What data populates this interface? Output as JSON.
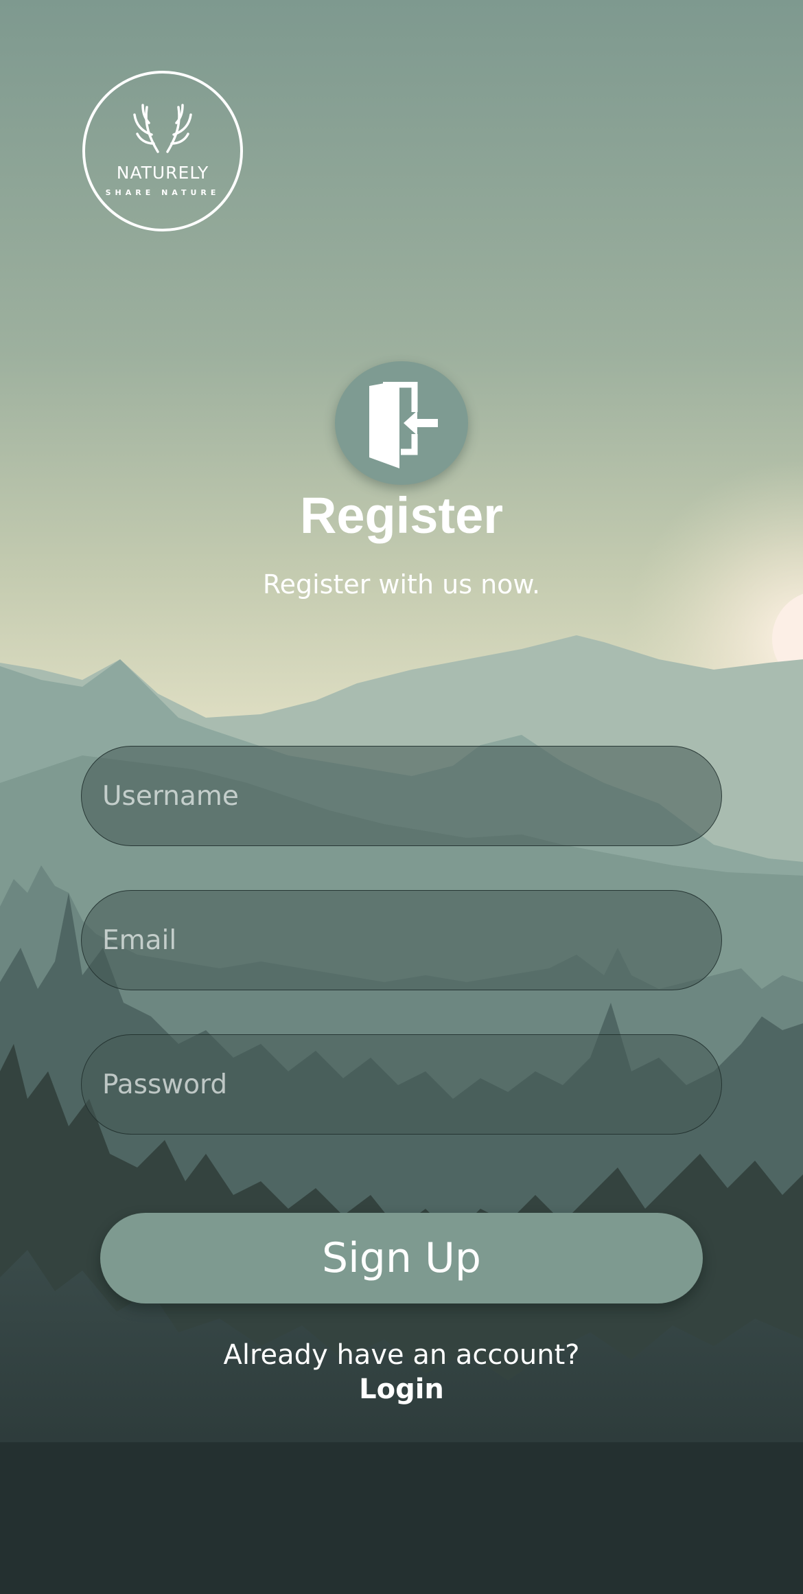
{
  "brand": {
    "name": "NATURELY",
    "tagline": "SHARE NATURE"
  },
  "header": {
    "icon": "door-enter-icon",
    "title": "Register",
    "subtitle": "Register with us now."
  },
  "form": {
    "username": {
      "placeholder": "Username",
      "value": ""
    },
    "email": {
      "placeholder": "Email",
      "value": ""
    },
    "password": {
      "placeholder": "Password",
      "value": ""
    },
    "submit_label": "Sign Up"
  },
  "footer": {
    "prompt": "Already have an account?",
    "login_label": "Login"
  },
  "colors": {
    "accent": "#7E9A90",
    "sky_top": "#7E998F",
    "sky_glow": "#E3E2C6",
    "forest_dark": "#243030"
  }
}
